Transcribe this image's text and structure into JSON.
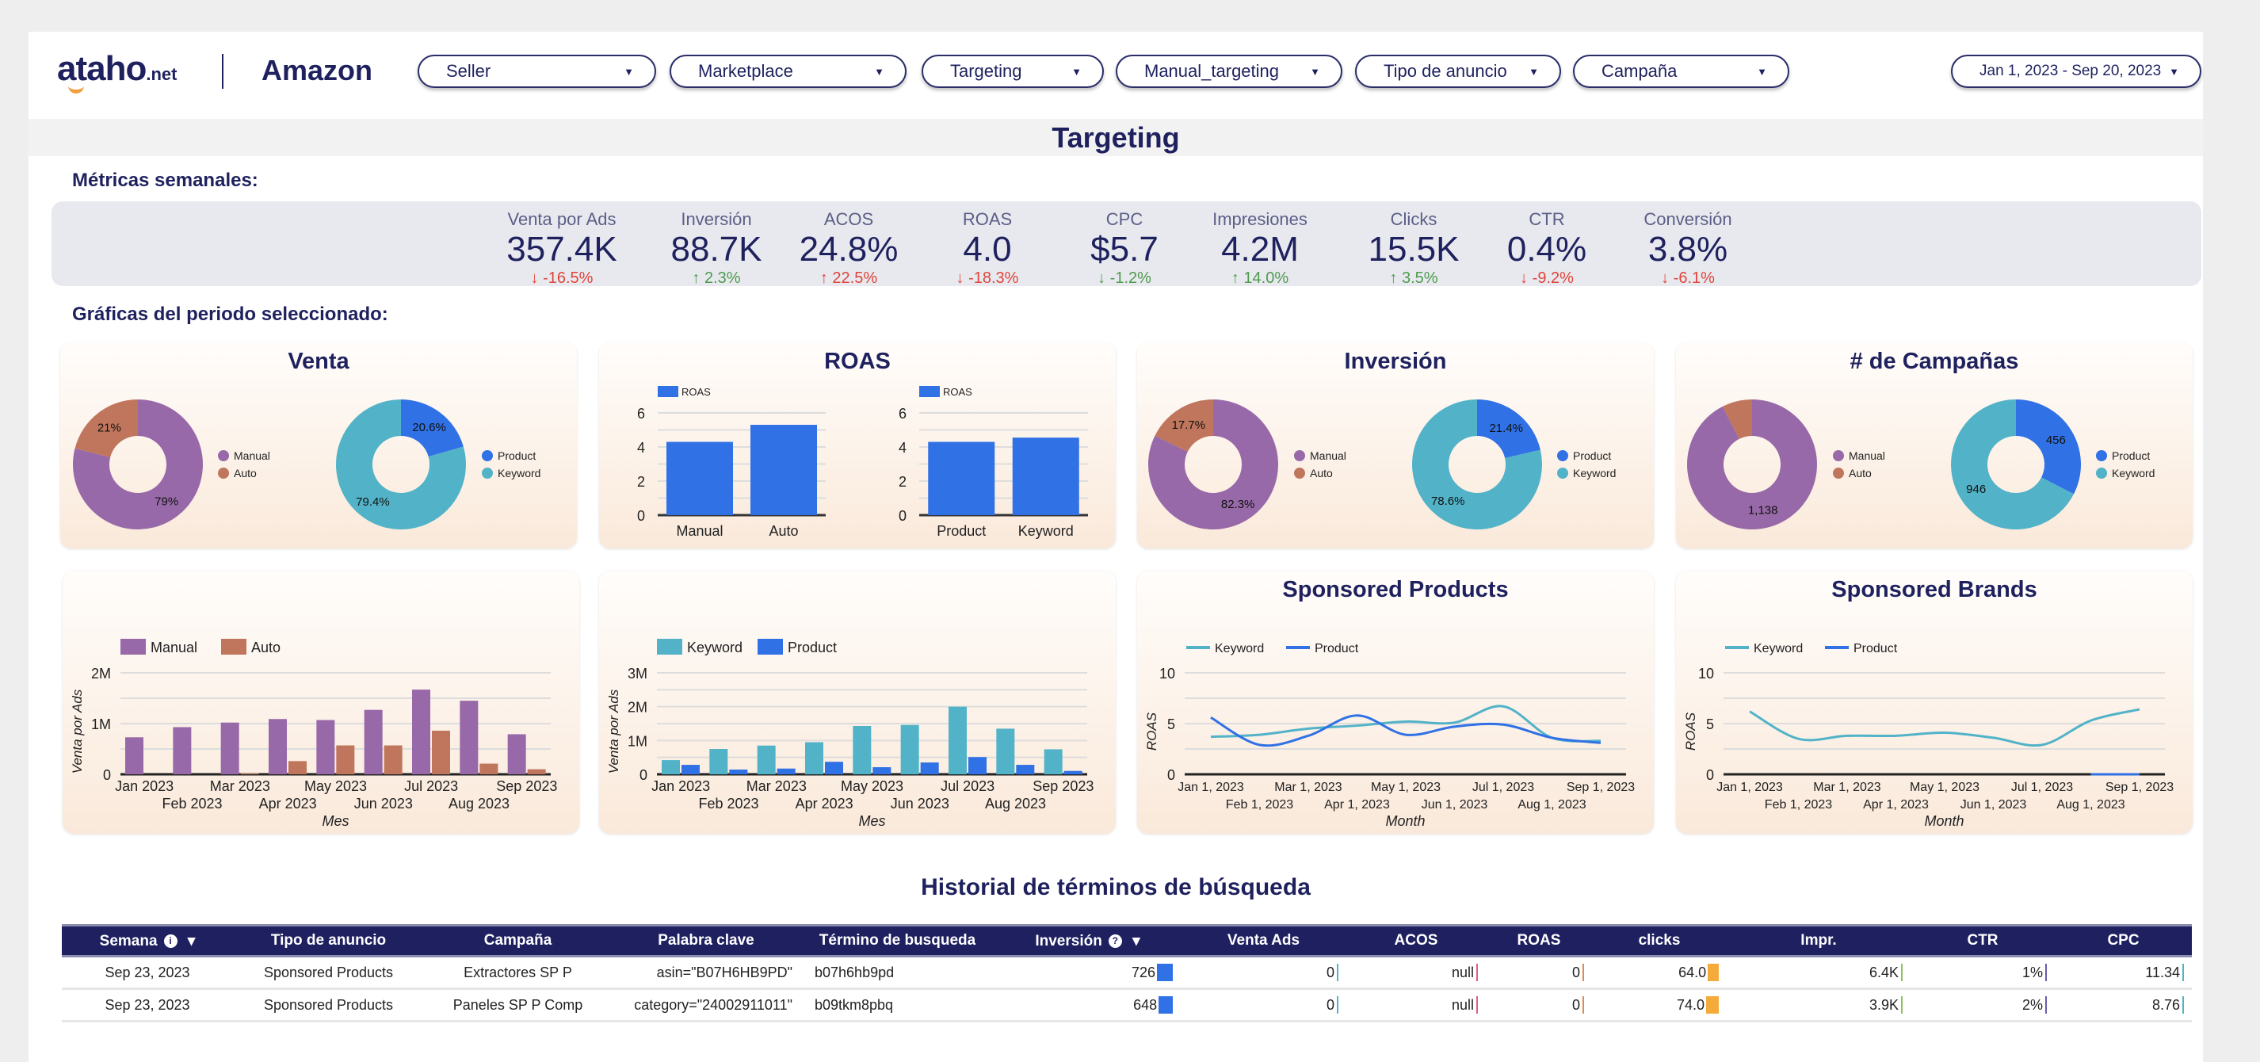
{
  "header": {
    "logo_text": "ataho",
    "logo_suffix": ".net",
    "brand": "Amazon",
    "filters": [
      {
        "label": "Seller"
      },
      {
        "label": "Marketplace"
      },
      {
        "label": "Targeting"
      },
      {
        "label": "Manual_targeting"
      },
      {
        "label": "Tipo de anuncio"
      },
      {
        "label": "Campaña"
      }
    ],
    "date_range": "Jan 1, 2023 - Sep 20, 2023"
  },
  "page_title": "Targeting",
  "metrics_heading": "Métricas semanales:",
  "metrics": [
    {
      "label": "Venta por Ads",
      "value": "357.4K",
      "delta": "-16.5%",
      "trend": "down"
    },
    {
      "label": "Inversión",
      "value": "88.7K",
      "delta": "2.3%",
      "trend": "up"
    },
    {
      "label": "ACOS",
      "value": "24.8%",
      "delta": "22.5%",
      "trend": "up-bad"
    },
    {
      "label": "ROAS",
      "value": "4.0",
      "delta": "-18.3%",
      "trend": "down"
    },
    {
      "label": "CPC",
      "value": "$5.7",
      "delta": "-1.2%",
      "trend": "down-good"
    },
    {
      "label": "Impresiones",
      "value": "4.2M",
      "delta": "14.0%",
      "trend": "up"
    },
    {
      "label": "Clicks",
      "value": "15.5K",
      "delta": "3.5%",
      "trend": "up"
    },
    {
      "label": "CTR",
      "value": "0.4%",
      "delta": "-9.2%",
      "trend": "down"
    },
    {
      "label": "Conversión",
      "value": "3.8%",
      "delta": "-6.1%",
      "trend": "down"
    }
  ],
  "charts_heading": "Gráficas del periodo seleccionado:",
  "panels": {
    "venta": "Venta",
    "roas": "ROAS",
    "inversion": "Inversión",
    "campanas": "# de Campañas",
    "sp": "Sponsored Products",
    "sb": "Sponsored Brands"
  },
  "colors": {
    "manual": "#9869a8",
    "auto": "#c0765d",
    "product": "#3071e5",
    "keyword": "#52b3c8",
    "navy": "#1e215e",
    "up": "#4e9a4e",
    "down": "#e0443a"
  },
  "chart_data": [
    {
      "type": "pie",
      "panel": "Venta",
      "labels": [
        "Manual",
        "Auto"
      ],
      "values": [
        79,
        21
      ],
      "data_labels": [
        "79%",
        "21%"
      ]
    },
    {
      "type": "pie",
      "panel": "Venta",
      "labels": [
        "Product",
        "Keyword"
      ],
      "values": [
        20.6,
        79.4
      ],
      "data_labels": [
        "20.6%",
        "79.4%"
      ]
    },
    {
      "type": "bar",
      "panel": "ROAS",
      "legend": "ROAS",
      "categories": [
        "Manual",
        "Auto"
      ],
      "values": [
        4.3,
        5.3
      ],
      "ylim": [
        0,
        6
      ],
      "yticks": [
        "0",
        "2",
        "4",
        "6"
      ]
    },
    {
      "type": "bar",
      "panel": "ROAS",
      "legend": "ROAS",
      "categories": [
        "Product",
        "Keyword"
      ],
      "values": [
        4.3,
        4.55
      ],
      "ylim": [
        0,
        6
      ],
      "yticks": [
        "0",
        "2",
        "4",
        "6"
      ]
    },
    {
      "type": "pie",
      "panel": "Inversión",
      "labels": [
        "Manual",
        "Auto"
      ],
      "values": [
        82.3,
        17.7
      ],
      "data_labels": [
        "82.3%",
        "17.7%"
      ]
    },
    {
      "type": "pie",
      "panel": "Inversión",
      "labels": [
        "Product",
        "Keyword"
      ],
      "values": [
        21.4,
        78.6
      ],
      "data_labels": [
        "21.4%",
        "78.6%"
      ]
    },
    {
      "type": "pie",
      "panel": "# de Campañas",
      "labels": [
        "Manual",
        "Auto"
      ],
      "values": [
        1138,
        92
      ],
      "data_labels": [
        "1,138",
        ""
      ]
    },
    {
      "type": "pie",
      "panel": "# de Campañas",
      "labels": [
        "Product",
        "Keyword"
      ],
      "values": [
        456,
        946
      ],
      "data_labels": [
        "456",
        "946"
      ]
    },
    {
      "type": "bar",
      "xlabel": "Mes",
      "ylabel": "Venta por Ads",
      "categories": [
        "Jan 2023",
        "Feb 2023",
        "Mar 2023",
        "Apr 2023",
        "May 2023",
        "Jun 2023",
        "Jul 2023",
        "Aug 2023",
        "Sep 2023"
      ],
      "series": [
        {
          "name": "Manual",
          "values": [
            730000,
            930000,
            1020000,
            1090000,
            1070000,
            1270000,
            1670000,
            1450000,
            790000
          ]
        },
        {
          "name": "Auto",
          "values": [
            0,
            0,
            20000,
            260000,
            570000,
            570000,
            860000,
            210000,
            100000
          ]
        }
      ],
      "ylim": [
        0,
        2000000
      ],
      "yticks": [
        "0",
        "1M",
        "2M"
      ],
      "grid": true,
      "legend": "top-left"
    },
    {
      "type": "bar",
      "xlabel": "Mes",
      "ylabel": "Venta por Ads",
      "categories": [
        "Jan 2023",
        "Feb 2023",
        "Mar 2023",
        "Apr 2023",
        "May 2023",
        "Jun 2023",
        "Jul 2023",
        "Aug 2023",
        "Sep 2023"
      ],
      "series": [
        {
          "name": "Keyword",
          "values": [
            420000,
            750000,
            850000,
            950000,
            1430000,
            1460000,
            2000000,
            1350000,
            740000
          ]
        },
        {
          "name": "Product",
          "values": [
            280000,
            140000,
            170000,
            370000,
            210000,
            350000,
            510000,
            280000,
            100000
          ]
        }
      ],
      "ylim": [
        0,
        3000000
      ],
      "yticks": [
        "0",
        "1M",
        "2M",
        "3M"
      ],
      "grid": true,
      "legend": "top-left"
    },
    {
      "type": "line",
      "panel": "Sponsored Products",
      "xlabel": "Month",
      "ylabel": "ROAS",
      "x": [
        "Jan 1, 2023",
        "Feb 1, 2023",
        "Mar 1, 2023",
        "Apr 1, 2023",
        "May 1, 2023",
        "Jun 1, 2023",
        "Jul 1, 2023",
        "Aug 1, 2023",
        "Sep 1, 2023"
      ],
      "series": [
        {
          "name": "Keyword",
          "values": [
            3.7,
            3.9,
            4.5,
            4.8,
            5.2,
            5.1,
            6.7,
            3.6,
            3.3
          ]
        },
        {
          "name": "Product",
          "values": [
            5.6,
            2.9,
            3.8,
            5.8,
            3.9,
            4.7,
            4.9,
            3.6,
            3.1
          ]
        }
      ],
      "ylim": [
        0,
        10
      ],
      "yticks": [
        "0",
        "5",
        "10"
      ],
      "grid": true,
      "legend": "top-left"
    },
    {
      "type": "line",
      "panel": "Sponsored Brands",
      "xlabel": "Month",
      "ylabel": "ROAS",
      "x": [
        "Jan 1, 2023",
        "Feb 1, 2023",
        "Mar 1, 2023",
        "Apr 1, 2023",
        "May 1, 2023",
        "Jun 1, 2023",
        "Jul 1, 2023",
        "Aug 1, 2023",
        "Sep 1, 2023"
      ],
      "series": [
        {
          "name": "Keyword",
          "values": [
            6.2,
            3.5,
            3.8,
            3.8,
            4.1,
            3.6,
            2.9,
            5.3,
            6.4
          ]
        },
        {
          "name": "Product",
          "values": [
            null,
            null,
            null,
            null,
            null,
            null,
            null,
            0,
            0
          ]
        }
      ],
      "ylim": [
        0,
        10
      ],
      "yticks": [
        "0",
        "5",
        "10"
      ],
      "grid": true,
      "legend": "top-left"
    }
  ],
  "table": {
    "title": "Historial de términos de búsqueda",
    "columns": [
      "Semana",
      "Tipo de anuncio",
      "Campaña",
      "Palabra clave",
      "Término de busqueda",
      "Inversión",
      "Venta Ads",
      "ACOS",
      "ROAS",
      "clicks",
      "Impr.",
      "CTR",
      "CPC"
    ],
    "rows": [
      {
        "semana": "Sep 23, 2023",
        "tipo": "Sponsored Products",
        "campana": "Extractores SP P",
        "palabra": "asin=\"B07H6HB9PD\"",
        "termino": "b07h6hb9pd",
        "inversion": "726",
        "venta": "0",
        "acos": "null",
        "roas": "0",
        "clicks": "64.0",
        "impr": "6.4K",
        "ctr": "1%",
        "cpc": "11.34"
      },
      {
        "semana": "Sep 23, 2023",
        "tipo": "Sponsored Products",
        "campana": "Paneles SP P Comp",
        "palabra": "category=\"24002911011\"",
        "termino": "b09tkm8pbq",
        "inversion": "648",
        "venta": "0",
        "acos": "null",
        "roas": "0",
        "clicks": "74.0",
        "impr": "3.9K",
        "ctr": "2%",
        "cpc": "8.76"
      }
    ],
    "bar_colors": {
      "inversion": "#3071e5",
      "venta": "#52b3c8",
      "acos": "#e05a8a",
      "roas": "#e08a50",
      "clicks": "#f4ab3a",
      "impr": "#8fc060",
      "ctr": "#6a5aa8",
      "cpc": "#52b3c8"
    }
  }
}
